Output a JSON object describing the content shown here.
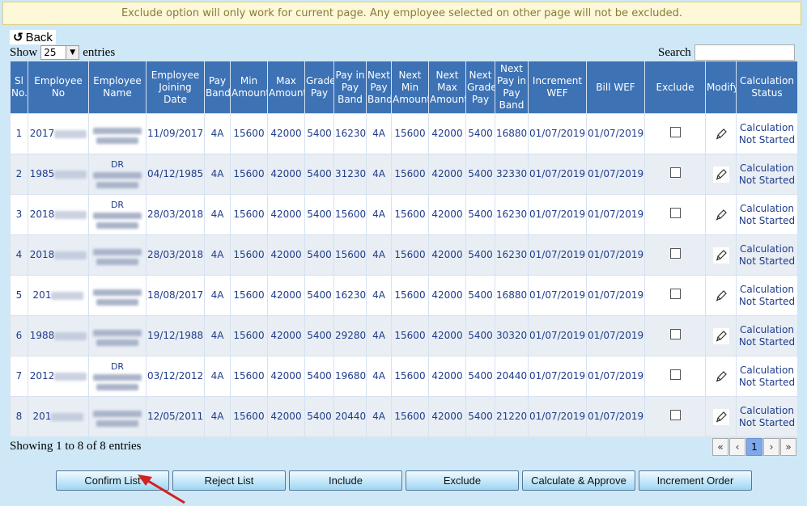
{
  "notice": "Exclude option will only work for current page. Any employee selected on other page will not be excluded.",
  "back_label": "Back",
  "length": {
    "show": "Show",
    "value": "25",
    "entries": "entries"
  },
  "search_label": "Search",
  "columns": [
    "Sl No.",
    "Employee No",
    "Employee Name",
    "Employee Joining Date",
    "Pay Band",
    "Min Amount",
    "Max Amount",
    "Grade Pay",
    "Pay in Pay Band",
    "Next Pay Band",
    "Next Min Amount",
    "Next Max Amount",
    "Next Grade Pay",
    "Next Pay in Pay Band",
    "Increment WEF",
    "Bill WEF",
    "Exclude",
    "Modify",
    "Calculation Status"
  ],
  "rows": [
    {
      "sl": "1",
      "emp_prefix": "2017",
      "name_prefix": "",
      "join": "11/09/2017",
      "pb": "4A",
      "min": "15600",
      "max": "42000",
      "gp": "5400",
      "pay": "16230",
      "npb": "4A",
      "nmin": "15600",
      "nmax": "42000",
      "ngp": "5400",
      "npay": "16880",
      "inc": "01/07/2019",
      "bill": "01/07/2019",
      "status": "Calculation Not Started"
    },
    {
      "sl": "2",
      "emp_prefix": "1985",
      "name_prefix": "DR",
      "join": "04/12/1985",
      "pb": "4A",
      "min": "15600",
      "max": "42000",
      "gp": "5400",
      "pay": "31230",
      "npb": "4A",
      "nmin": "15600",
      "nmax": "42000",
      "ngp": "5400",
      "npay": "32330",
      "inc": "01/07/2019",
      "bill": "01/07/2019",
      "status": "Calculation Not Started"
    },
    {
      "sl": "3",
      "emp_prefix": "2018",
      "name_prefix": "DR",
      "join": "28/03/2018",
      "pb": "4A",
      "min": "15600",
      "max": "42000",
      "gp": "5400",
      "pay": "15600",
      "npb": "4A",
      "nmin": "15600",
      "nmax": "42000",
      "ngp": "5400",
      "npay": "16230",
      "inc": "01/07/2019",
      "bill": "01/07/2019",
      "status": "Calculation Not Started"
    },
    {
      "sl": "4",
      "emp_prefix": "2018",
      "name_prefix": "",
      "join": "28/03/2018",
      "pb": "4A",
      "min": "15600",
      "max": "42000",
      "gp": "5400",
      "pay": "15600",
      "npb": "4A",
      "nmin": "15600",
      "nmax": "42000",
      "ngp": "5400",
      "npay": "16230",
      "inc": "01/07/2019",
      "bill": "01/07/2019",
      "status": "Calculation Not Started"
    },
    {
      "sl": "5",
      "emp_prefix": "201",
      "name_prefix": "",
      "join": "18/08/2017",
      "pb": "4A",
      "min": "15600",
      "max": "42000",
      "gp": "5400",
      "pay": "16230",
      "npb": "4A",
      "nmin": "15600",
      "nmax": "42000",
      "ngp": "5400",
      "npay": "16880",
      "inc": "01/07/2019",
      "bill": "01/07/2019",
      "status": "Calculation Not Started"
    },
    {
      "sl": "6",
      "emp_prefix": "1988",
      "name_prefix": "",
      "join": "19/12/1988",
      "pb": "4A",
      "min": "15600",
      "max": "42000",
      "gp": "5400",
      "pay": "29280",
      "npb": "4A",
      "nmin": "15600",
      "nmax": "42000",
      "ngp": "5400",
      "npay": "30320",
      "inc": "01/07/2019",
      "bill": "01/07/2019",
      "status": "Calculation Not Started"
    },
    {
      "sl": "7",
      "emp_prefix": "2012",
      "name_prefix": "DR",
      "join": "03/12/2012",
      "pb": "4A",
      "min": "15600",
      "max": "42000",
      "gp": "5400",
      "pay": "19680",
      "npb": "4A",
      "nmin": "15600",
      "nmax": "42000",
      "ngp": "5400",
      "npay": "20440",
      "inc": "01/07/2019",
      "bill": "01/07/2019",
      "status": "Calculation Not Started"
    },
    {
      "sl": "8",
      "emp_prefix": "201",
      "name_prefix": "",
      "join": "12/05/2011",
      "pb": "4A",
      "min": "15600",
      "max": "42000",
      "gp": "5400",
      "pay": "20440",
      "npb": "4A",
      "nmin": "15600",
      "nmax": "42000",
      "ngp": "5400",
      "npay": "21220",
      "inc": "01/07/2019",
      "bill": "01/07/2019",
      "status": "Calculation Not Started"
    }
  ],
  "info": "Showing 1 to 8 of 8 entries",
  "pagination": {
    "first": "«",
    "prev": "‹",
    "current": "1",
    "next": "›",
    "last": "»"
  },
  "actions": [
    "Confirm List",
    "Reject List",
    "Include",
    "Exclude",
    "Calculate & Approve",
    "Increment Order"
  ],
  "colors": {
    "header": "#3d72b4",
    "page_bg": "#cfe8f7",
    "notice_bg": "#fcf8d8",
    "cell_text": "#1f3c8a",
    "arrow": "#d42020"
  },
  "icons": {
    "back": "undo-arrow-icon",
    "modify": "pencil-icon",
    "annotation": "red-arrow-icon"
  }
}
